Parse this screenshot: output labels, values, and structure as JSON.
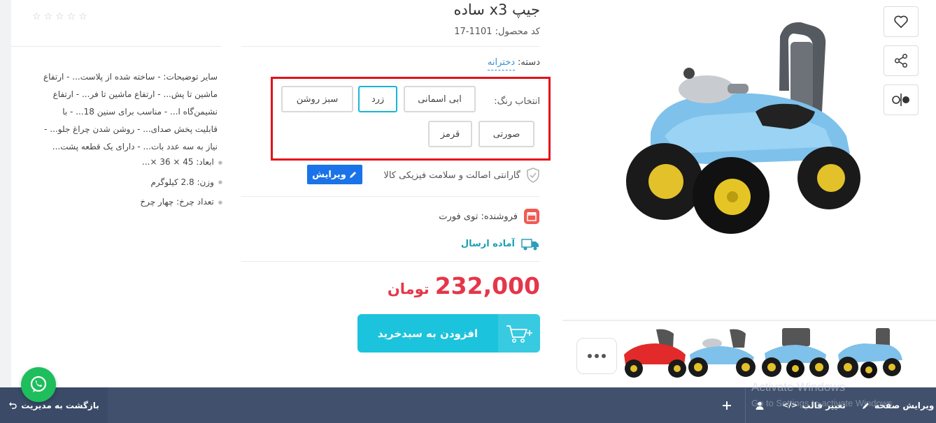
{
  "product": {
    "title": "جیپ x3 ساده",
    "code_label": "کد محصول:",
    "code": "1101-17",
    "category_label": "دسته:",
    "category": "دخترانه"
  },
  "colors": {
    "label": "انتخاب رنگ:",
    "options": [
      "ابی اسمانی",
      "زرد",
      "سبز روشن",
      "صورتی",
      "قرمز"
    ],
    "selected": "زرد"
  },
  "guarantee": "گارانتی اصالت و سلامت فیزیکی کالا",
  "edit_label": "ویرایش",
  "seller": {
    "label": "فروشنده:",
    "name": "توی فورت"
  },
  "shipping": "آماده ارسال",
  "price": {
    "value": "232,000",
    "currency": "تومان"
  },
  "cart_button": "افزودن به سبدخرید",
  "description": [
    "سایر توضیحات: - ساخته شده از پلاست... - ارتفاع",
    "ماشین تا پش... - ارتفاع ماشین تا فر... - ارتفاع",
    "نشیمن‌گاه ا... - مناسب برای سنین 18... - با",
    "قابلیت پخش صدای... - روشن شدن چراغ جلو... -",
    "نیاز به سه عدد بات... - دارای یک قطعه پشت..."
  ],
  "attributes": [
    "ابعاد: 45 × 36 ×...",
    "وزن: 2.8 کیلوگرم",
    "تعداد چرخ: چهار چرخ"
  ],
  "admin_bar": {
    "back": "بازگشت به مدیریت",
    "edit_page": "ویرایش صفحه",
    "change_template": "تغییر قالب"
  },
  "watermark": {
    "line1": "Activate Windows",
    "line2": "Go to Settings to activate Windows."
  },
  "accent_colors": {
    "primary": "#1cc3dc",
    "price": "#e5364a",
    "highlight": "#e3101a",
    "edit": "#1a73e8"
  }
}
